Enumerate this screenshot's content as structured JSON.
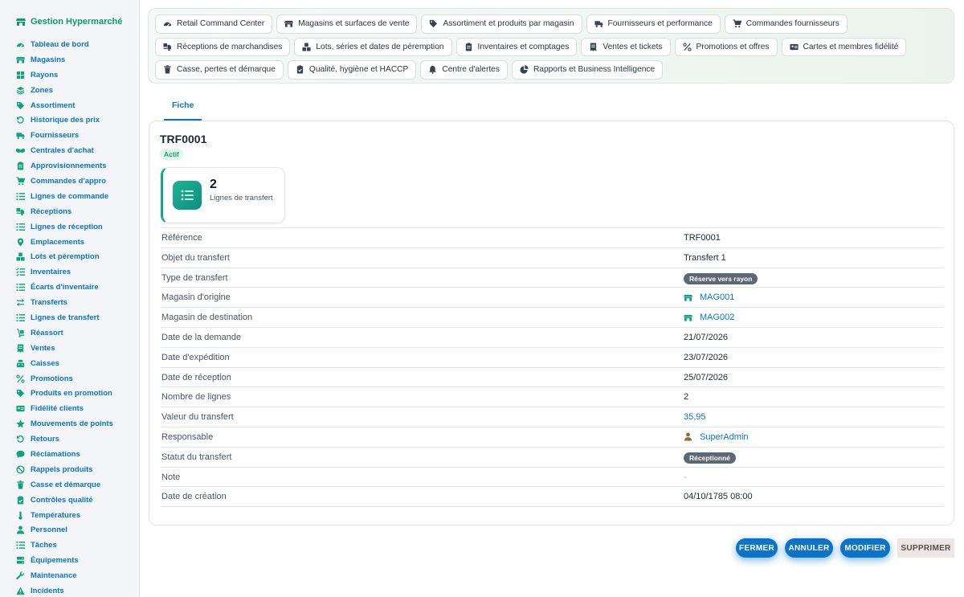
{
  "app": {
    "title": "Gestion Hypermarché"
  },
  "sidebar": {
    "items": [
      {
        "label": "Tableau de bord",
        "icon": "gauge-icon"
      },
      {
        "label": "Magasins",
        "icon": "store-icon"
      },
      {
        "label": "Rayons",
        "icon": "grid-icon"
      },
      {
        "label": "Zones",
        "icon": "layers-icon"
      },
      {
        "label": "Assortiment",
        "icon": "tags-icon"
      },
      {
        "label": "Historique des prix",
        "icon": "history-icon"
      },
      {
        "label": "Fournisseurs",
        "icon": "truck-icon"
      },
      {
        "label": "Centrales d'achat",
        "icon": "handshake-icon"
      },
      {
        "label": "Approvisionnements",
        "icon": "clipboard-icon"
      },
      {
        "label": "Commandes d'appro",
        "icon": "cart-icon"
      },
      {
        "label": "Lignes de commande",
        "icon": "list-icon"
      },
      {
        "label": "Réceptions",
        "icon": "truck-loading-icon"
      },
      {
        "label": "Lignes de réception",
        "icon": "list-icon"
      },
      {
        "label": "Emplacements",
        "icon": "location-pin-icon"
      },
      {
        "label": "Lots et péremption",
        "icon": "cubes-icon"
      },
      {
        "label": "Inventaires",
        "icon": "list-check-icon"
      },
      {
        "label": "Écarts d'inventaire",
        "icon": "list-icon"
      },
      {
        "label": "Transferts",
        "icon": "transfer-icon"
      },
      {
        "label": "Lignes de transfert",
        "icon": "list-icon"
      },
      {
        "label": "Réassort",
        "icon": "dolly-icon"
      },
      {
        "label": "Ventes",
        "icon": "receipt-icon"
      },
      {
        "label": "Caisses",
        "icon": "cash-register-icon"
      },
      {
        "label": "Promotions",
        "icon": "percent-icon"
      },
      {
        "label": "Produits en promotion",
        "icon": "tag-icon"
      },
      {
        "label": "Fidélité clients",
        "icon": "id-card-icon"
      },
      {
        "label": "Mouvements de points",
        "icon": "star-icon"
      },
      {
        "label": "Retours",
        "icon": "undo-icon"
      },
      {
        "label": "Réclamations",
        "icon": "comment-icon"
      },
      {
        "label": "Rappels produits",
        "icon": "ban-icon"
      },
      {
        "label": "Casse et démarque",
        "icon": "trash-icon"
      },
      {
        "label": "Contrôles qualité",
        "icon": "clipboard-check-icon"
      },
      {
        "label": "Températures",
        "icon": "thermometer-icon"
      },
      {
        "label": "Personnel",
        "icon": "user-icon"
      },
      {
        "label": "Tâches",
        "icon": "list-icon"
      },
      {
        "label": "Équipements",
        "icon": "server-icon"
      },
      {
        "label": "Maintenance",
        "icon": "wrench-icon"
      },
      {
        "label": "Incidents",
        "icon": "warning-icon"
      }
    ]
  },
  "topnav": {
    "chips": [
      {
        "label": "Retail Command Center",
        "icon": "gauge-icon"
      },
      {
        "label": "Magasins et surfaces de vente",
        "icon": "store-icon"
      },
      {
        "label": "Assortiment et produits par magasin",
        "icon": "tags-icon"
      },
      {
        "label": "Fournisseurs et performance",
        "icon": "truck-icon"
      },
      {
        "label": "Commandes fournisseurs",
        "icon": "cart-icon"
      },
      {
        "label": "Réceptions de marchandises",
        "icon": "truck-loading-icon"
      },
      {
        "label": "Lots, séries et dates de péremption",
        "icon": "cubes-icon"
      },
      {
        "label": "Inventaires et comptages",
        "icon": "clipboard-icon"
      },
      {
        "label": "Ventes et tickets",
        "icon": "receipt-icon"
      },
      {
        "label": "Promotions et offres",
        "icon": "percent-icon"
      },
      {
        "label": "Cartes et membres fidélité",
        "icon": "id-card-icon"
      },
      {
        "label": "Casse, pertes et démarque",
        "icon": "trash-icon"
      },
      {
        "label": "Qualité, hygiène et HACCP",
        "icon": "clipboard-check-icon"
      },
      {
        "label": "Centre d'alertes",
        "icon": "bell-icon"
      },
      {
        "label": "Rapports et Business Intelligence",
        "icon": "pie-chart-icon"
      }
    ]
  },
  "tabs": [
    {
      "label": "Fiche"
    }
  ],
  "record": {
    "title": "TRF0001",
    "status": "Actif",
    "stat": {
      "value": "2",
      "label": "Lignes de transfert"
    },
    "fields": [
      {
        "label": "Référence",
        "value": "TRF0001",
        "kind": "text"
      },
      {
        "label": "Objet du transfert",
        "value": "Transfert 1",
        "kind": "text"
      },
      {
        "label": "Type de transfert",
        "value": "Réserve vers rayon",
        "kind": "badge"
      },
      {
        "label": "Magasin d'origine",
        "value": "MAG001",
        "kind": "link",
        "icon": "store-icon"
      },
      {
        "label": "Magasin de destination",
        "value": "MAG002",
        "kind": "link",
        "icon": "store-icon"
      },
      {
        "label": "Date de la demande",
        "value": "21/07/2026",
        "kind": "text"
      },
      {
        "label": "Date d'expédition",
        "value": "23/07/2026",
        "kind": "text"
      },
      {
        "label": "Date de réception",
        "value": "25/07/2026",
        "kind": "text"
      },
      {
        "label": "Nombre de lignes",
        "value": "2",
        "kind": "text"
      },
      {
        "label": "Valeur du transfert",
        "value": "35,95",
        "kind": "link"
      },
      {
        "label": "Responsable",
        "value": "SuperAdmin",
        "kind": "link",
        "icon": "user-icon"
      },
      {
        "label": "Statut du transfert",
        "value": "Réceptionné",
        "kind": "badge"
      },
      {
        "label": "Note",
        "value": "-",
        "kind": "muted"
      },
      {
        "label": "Date de création",
        "value": "04/10/1785 08:00",
        "kind": "text"
      }
    ]
  },
  "actions": {
    "close": "FERMER",
    "cancel": "ANNULER",
    "edit": "MODIFIER",
    "delete": "SUPPRIMER"
  },
  "colors": {
    "accent": "#0b74c9",
    "brand": "#0a9a6e",
    "sidebar_icon": "#10a37f",
    "active": "#18a36f",
    "badge": "#5d6876"
  }
}
